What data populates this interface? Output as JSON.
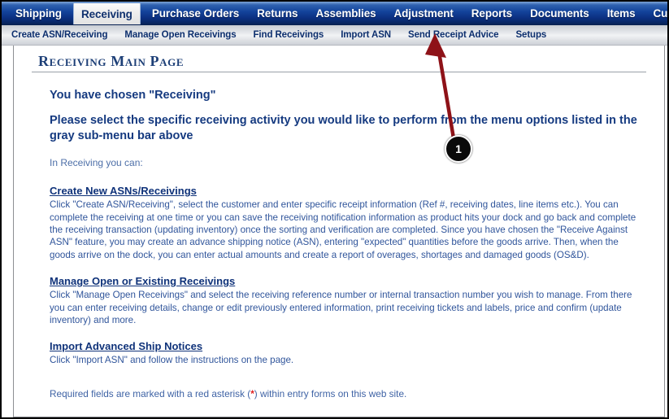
{
  "window": {
    "page_title": "Receiving Main Page"
  },
  "mainnav": {
    "items": [
      {
        "label": "Shipping",
        "active": false
      },
      {
        "label": "Receiving",
        "active": true
      },
      {
        "label": "Purchase Orders",
        "active": false
      },
      {
        "label": "Returns",
        "active": false
      },
      {
        "label": "Assemblies",
        "active": false
      },
      {
        "label": "Adjustment",
        "active": false
      },
      {
        "label": "Reports",
        "active": false
      },
      {
        "label": "Documents",
        "active": false
      },
      {
        "label": "Items",
        "active": false
      },
      {
        "label": "Customers",
        "active": false
      }
    ],
    "active_tab": "Receiving",
    "bg_color": "#13439b",
    "active_bg_color": "#eeeeee",
    "text_color": "#ffffff"
  },
  "subnav": {
    "items": [
      {
        "label": "Create ASN/Receiving"
      },
      {
        "label": "Manage Open Receivings"
      },
      {
        "label": "Find Receivings"
      },
      {
        "label": "Import ASN"
      },
      {
        "label": "Send Receipt Advice"
      },
      {
        "label": "Setups"
      }
    ],
    "text_color": "#0d2f6e"
  },
  "main": {
    "heading_1": "You have chosen \"Receiving\"",
    "heading_2": "Please select the specific receiving activity you would like to perform from the menu options listed in the gray sub-menu bar above",
    "lead": "In Receiving you can:",
    "sections": [
      {
        "link": "Create New ASNs/Receivings",
        "body": "Click \"Create ASN/Receiving\", select the customer and enter specific receipt information (Ref #, receiving dates, line items etc.). You can complete the receiving at one time or you can save the receiving notification information as product hits your dock and go back and complete the receiving transaction (updating inventory) once the sorting and verification are completed. Since you have chosen the \"Receive Against ASN\" feature, you may create an advance shipping notice (ASN), entering \"expected\" quantities before the goods arrive. Then, when the goods arrive on the dock, you can enter actual amounts and create a report of overages, shortages and damaged goods (OS&D)."
      },
      {
        "link": "Manage Open or Existing Receivings",
        "body": "Click \"Manage Open Receivings\" and select the receiving reference number or internal transaction number you wish to manage. From there you can enter receiving details, change or edit previously entered information, print receiving tickets and labels, price and confirm (update inventory) and more."
      },
      {
        "link": "Import Advanced Ship Notices",
        "body": "Click \"Import ASN\" and follow the instructions on the page."
      }
    ],
    "footnote_before": "Required fields are marked with a red asterisk (",
    "footnote_star": "*",
    "footnote_after": ") within entry forms on this web site.",
    "heading_color": "#153a80",
    "body_color": "#30559b",
    "link_color": "#10337a",
    "asterisk_color": "#e02020"
  },
  "annotation": {
    "badge_number": "1",
    "arrow_color": "#8e1218",
    "badge_bg_color": "#0a0a0a",
    "badge_text_color": "#ffffff",
    "points_to": "Send Receipt Advice"
  }
}
